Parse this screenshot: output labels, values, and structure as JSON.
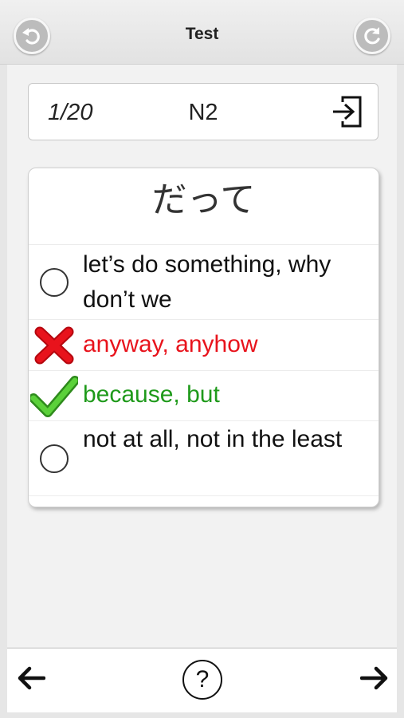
{
  "header": {
    "title": "Test",
    "back_icon": "undo-arrow-icon",
    "refresh_icon": "refresh-icon"
  },
  "info": {
    "counter": "1/20",
    "level": "N2",
    "exit_icon": "exit-icon"
  },
  "question": {
    "word": "だって",
    "options": [
      {
        "text": "let’s do something, why don’t we",
        "state": "unselected"
      },
      {
        "text": "anyway, anyhow",
        "state": "wrong",
        "color": "#e8131c"
      },
      {
        "text": "because, but",
        "state": "correct",
        "color": "#1f9a1b"
      },
      {
        "text": "not at all, not in the least",
        "state": "unselected"
      }
    ]
  },
  "toolbar": {
    "prev_icon": "arrow-left-icon",
    "help_label": "?",
    "next_icon": "arrow-right-icon"
  }
}
